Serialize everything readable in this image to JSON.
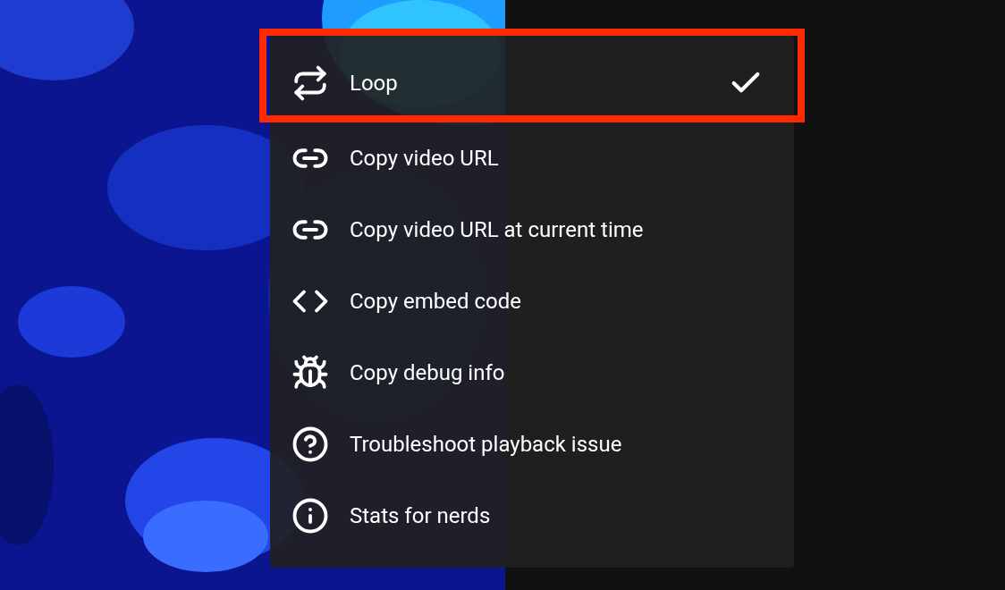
{
  "menu": {
    "items": [
      {
        "label": "Loop",
        "kind": "loop",
        "checked": true,
        "highlighted": true
      },
      {
        "label": "Copy video URL",
        "kind": "link",
        "checked": false,
        "highlighted": false
      },
      {
        "label": "Copy video URL at current time",
        "kind": "link",
        "checked": false,
        "highlighted": false
      },
      {
        "label": "Copy embed code",
        "kind": "code",
        "checked": false,
        "highlighted": false
      },
      {
        "label": "Copy debug info",
        "kind": "bug",
        "checked": false,
        "highlighted": false
      },
      {
        "label": "Troubleshoot playback issue",
        "kind": "help",
        "checked": false,
        "highlighted": false
      },
      {
        "label": "Stats for nerds",
        "kind": "info",
        "checked": false,
        "highlighted": false
      }
    ]
  }
}
